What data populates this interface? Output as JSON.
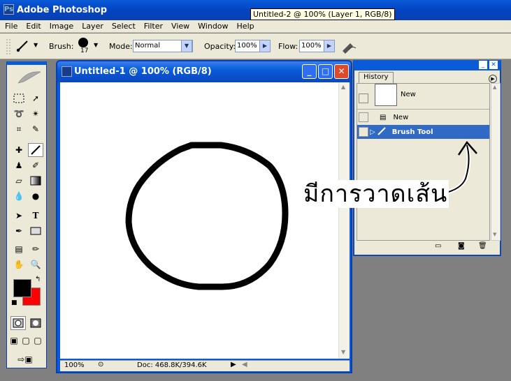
{
  "app": {
    "title": "Adobe Photoshop",
    "tooltip": "Untitled-2 @ 100% (Layer 1, RGB/8)"
  },
  "menu": [
    "File",
    "Edit",
    "Image",
    "Layer",
    "Select",
    "Filter",
    "View",
    "Window",
    "Help"
  ],
  "options": {
    "brush_label": "Brush:",
    "brush_size": "17",
    "mode_label": "Mode:",
    "mode_value": "Normal",
    "opacity_label": "Opacity:",
    "opacity_value": "100%",
    "flow_label": "Flow:",
    "flow_value": "100%"
  },
  "document": {
    "title": "Untitled-1 @ 100% (RGB/8)",
    "zoom": "100%",
    "doc_info": "Doc: 468.8K/394.6K"
  },
  "history": {
    "tab": "History",
    "snapshot_label": "New",
    "items": [
      {
        "label": "New",
        "selected": false
      },
      {
        "label": "Brush Tool",
        "selected": true
      }
    ]
  },
  "annotation": "มีการวาดเส้น",
  "colors": {
    "foreground": "#000000",
    "background": "#ff0000",
    "accent": "#0a5bd8",
    "selection": "#316ac5"
  }
}
